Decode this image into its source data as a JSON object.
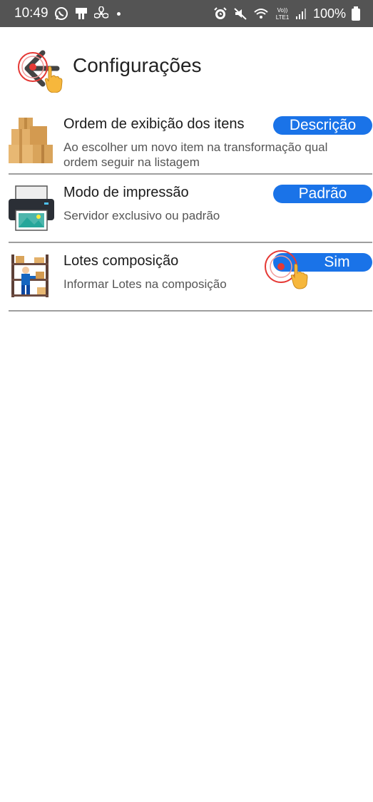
{
  "status_bar": {
    "time": "10:49",
    "battery_percent": "100%",
    "network_label_top": "Vo))",
    "network_label_bottom": "LTE1"
  },
  "header": {
    "title": "Configurações"
  },
  "settings": [
    {
      "title": "Ordem de exibição dos itens",
      "description": "Ao escolher um novo item na transformação qual ordem seguir na listagem",
      "value": "Descrição",
      "icon": "boxes-icon"
    },
    {
      "title": "Modo de impressão",
      "description": "Servidor exclusivo ou padrão",
      "value": "Padrão",
      "icon": "printer-icon"
    },
    {
      "title": "Lotes composição",
      "description": "Informar Lotes na composição",
      "value": "Sim",
      "icon": "warehouse-worker-icon"
    }
  ],
  "colors": {
    "accent": "#1a73e8",
    "status_bar": "#545454",
    "divider": "#9e9e9e"
  }
}
